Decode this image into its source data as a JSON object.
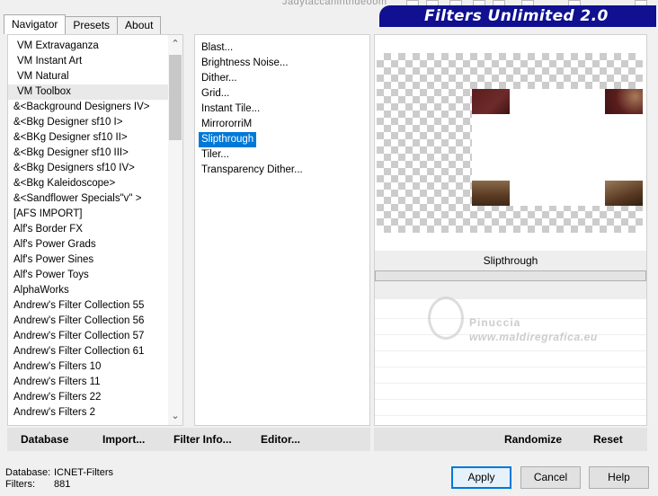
{
  "window": {
    "title": "Filters Unlimited 2.0",
    "behind_text": "Jadytaccanihthdeoom"
  },
  "tabs": [
    {
      "label": "Navigator",
      "active": true
    },
    {
      "label": "Presets",
      "active": false
    },
    {
      "label": "About",
      "active": false
    }
  ],
  "categories": [
    {
      "label": "VM Extravaganza",
      "indent": true
    },
    {
      "label": "VM Instant Art",
      "indent": true
    },
    {
      "label": "VM Natural",
      "indent": true
    },
    {
      "label": "VM Toolbox",
      "indent": true,
      "highlighted": true
    },
    {
      "label": "&<Background Designers IV>"
    },
    {
      "label": "&<Bkg Designer sf10 I>"
    },
    {
      "label": "&<BKg Designer sf10 II>"
    },
    {
      "label": "&<Bkg Designer sf10 III>"
    },
    {
      "label": "&<Bkg Designers sf10 IV>"
    },
    {
      "label": "&<Bkg Kaleidoscope>"
    },
    {
      "label": "&<Sandflower Specials\"v\" >"
    },
    {
      "label": "[AFS IMPORT]"
    },
    {
      "label": "Alf's Border FX"
    },
    {
      "label": "Alf's Power Grads"
    },
    {
      "label": "Alf's Power Sines"
    },
    {
      "label": "Alf's Power Toys"
    },
    {
      "label": "AlphaWorks"
    },
    {
      "label": "Andrew's Filter Collection 55"
    },
    {
      "label": "Andrew's Filter Collection 56"
    },
    {
      "label": "Andrew's Filter Collection 57"
    },
    {
      "label": "Andrew's Filter Collection 61"
    },
    {
      "label": "Andrew's Filters 10"
    },
    {
      "label": "Andrew's Filters 11"
    },
    {
      "label": "Andrew's Filters 22"
    },
    {
      "label": "Andrew's Filters 2"
    }
  ],
  "filters": [
    {
      "label": "Blast..."
    },
    {
      "label": "Brightness Noise..."
    },
    {
      "label": "Dither..."
    },
    {
      "label": "Grid..."
    },
    {
      "label": "Instant Tile..."
    },
    {
      "label": "MirrororriM"
    },
    {
      "label": "Slipthrough",
      "selected": true
    },
    {
      "label": "Tiler..."
    },
    {
      "label": "Transparency Dither..."
    }
  ],
  "preview": {
    "filter_name": "Slipthrough"
  },
  "watermark": {
    "line1": "Pinuccia",
    "line2": "www.maldiregrafica.eu"
  },
  "left_buttons": {
    "database": "Database",
    "import": "Import...",
    "filter_info": "Filter Info...",
    "editor": "Editor..."
  },
  "right_buttons": {
    "randomize": "Randomize",
    "reset": "Reset"
  },
  "status": {
    "database_label": "Database:",
    "database_value": "ICNET-Filters",
    "filters_label": "Filters:",
    "filters_value": "881"
  },
  "dialog_buttons": {
    "apply": "Apply",
    "cancel": "Cancel",
    "help": "Help"
  },
  "colors": {
    "banner": "#101090",
    "selection": "#0078d7"
  }
}
